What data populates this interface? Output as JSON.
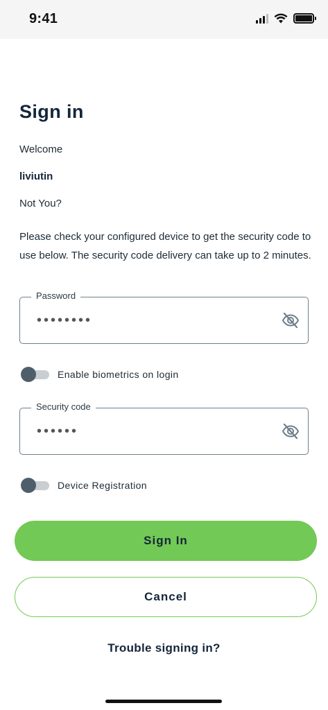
{
  "status_bar": {
    "time": "9:41",
    "icons": [
      "signal-icon",
      "wifi-icon",
      "battery-icon"
    ]
  },
  "page": {
    "title": "Sign in",
    "welcome": "Welcome",
    "username": "liviutin",
    "not_you": "Not You?",
    "instructions": "Please check your configured device to get the security code to use below. The security code delivery can take up to 2 minutes."
  },
  "password": {
    "label": "Password",
    "masked_value": "••••••••"
  },
  "biometrics": {
    "label": "Enable biometrics on login",
    "enabled": false
  },
  "security_code": {
    "label": "Security code",
    "masked_value": "••••••"
  },
  "device_registration": {
    "label": "Device Registration",
    "enabled": false
  },
  "buttons": {
    "sign_in": "Sign In",
    "cancel": "Cancel"
  },
  "trouble_link": "Trouble signing in?",
  "colors": {
    "accent_green": "#72c955",
    "text_dark": "#15263a",
    "toggle_knob": "#4e5f6b"
  }
}
